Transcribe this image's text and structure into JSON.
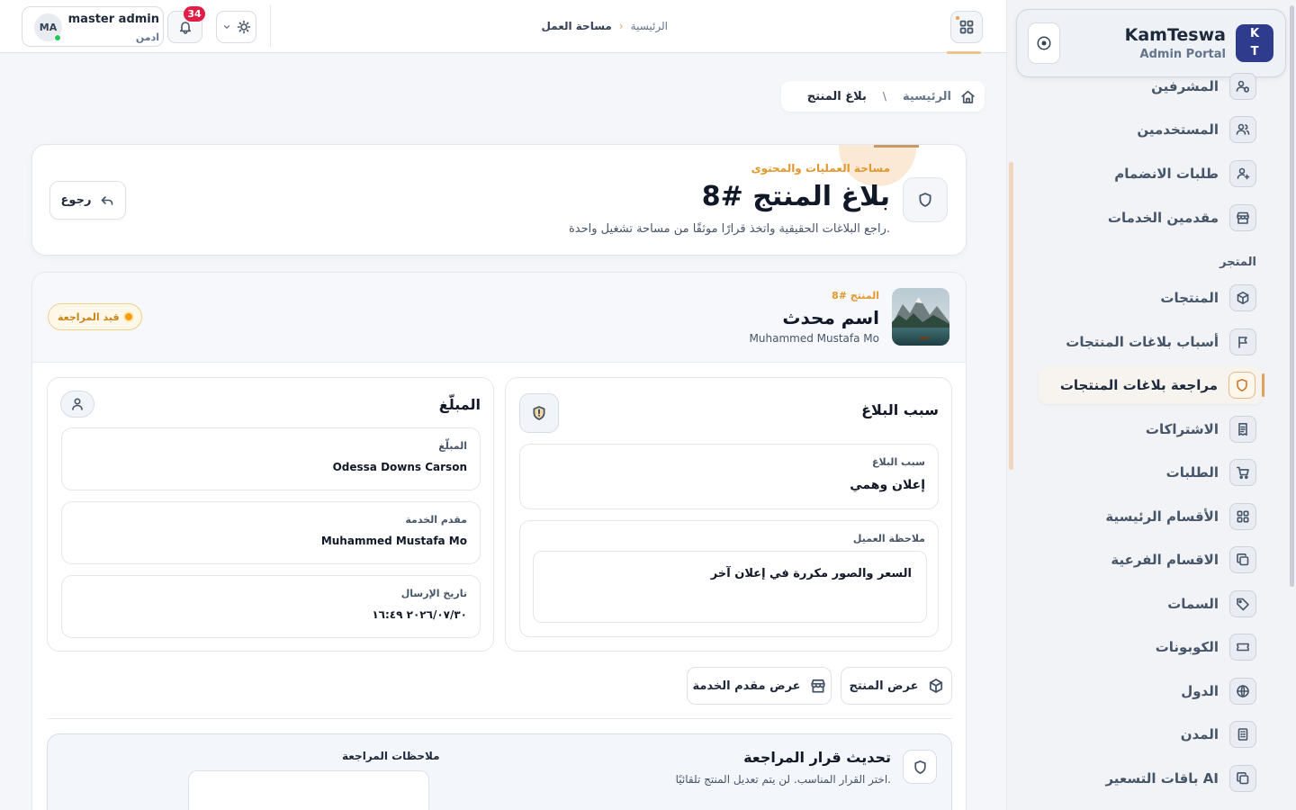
{
  "sidebar": {
    "brand_name": "KamTeswa",
    "brand_sub": "Admin Portal",
    "logo_line1": "K",
    "logo_line2": "T",
    "section_store": "المتجر",
    "items": [
      {
        "label": "المشرفين",
        "icon": "users-shield-icon"
      },
      {
        "label": "المستخدمين",
        "icon": "users-icon"
      },
      {
        "label": "طلبات الانضمام",
        "icon": "user-plus-icon"
      },
      {
        "label": "مقدمين الخدمات",
        "icon": "store-icon"
      },
      {
        "label": "المنتجات",
        "icon": "box-icon"
      },
      {
        "label": "أسباب بلاغات المنتجات",
        "icon": "flag-icon"
      },
      {
        "label": "مراجعة بلاغات المنتجات",
        "icon": "shield-icon",
        "active": true
      },
      {
        "label": "الاشتراكات",
        "icon": "receipt-icon"
      },
      {
        "label": "الطلبات",
        "icon": "cart-icon"
      },
      {
        "label": "الأقسام الرئيسية",
        "icon": "grid-icon"
      },
      {
        "label": "الاقسام الفرعية",
        "icon": "layers-icon"
      },
      {
        "label": "السمات",
        "icon": "tag-icon"
      },
      {
        "label": "الكوبونات",
        "icon": "ticket-icon"
      },
      {
        "label": "الدول",
        "icon": "globe-icon"
      },
      {
        "label": "المدن",
        "icon": "building-icon"
      },
      {
        "label": "باقات التسعير AI",
        "icon": "copy-icon"
      }
    ]
  },
  "topbar": {
    "breadcrumb_home": "الرئيسية",
    "breadcrumb_separator": "›",
    "breadcrumb_current": "مساحة العمل",
    "notifications_count": "34",
    "user_initials": "MA",
    "user_name": "master admin",
    "user_role": "ادمن"
  },
  "page": {
    "crumb_home": "الرئيسية",
    "crumb_sep": "\\",
    "crumb_current": "بلاغ المنتج",
    "kicker": "مساحة العمليات والمحتوى",
    "title": "بلاغ المنتج #8",
    "description": "راجع البلاغات الحقيقية واتخذ قرارًا موثقًا من مساحة تشغيل واحدة.",
    "back_label": "رجوع"
  },
  "product": {
    "number": "المنتج #8",
    "name": "اسم محدث",
    "provider": "Muhammed Mustafa Mo",
    "status": "قيد المراجعة",
    "status_color": "#f59e0b"
  },
  "reason_panel": {
    "title": "سبب البلاغ",
    "reason_label": "سبب البلاغ",
    "reason_value": "إعلان وهمي",
    "note_label": "ملاحظة العميل",
    "note_value": "السعر والصور مكررة في إعلان آخر"
  },
  "reporter_panel": {
    "title": "المبلّغ",
    "reporter_label": "المبلّغ",
    "reporter_value": "Odessa Downs Carson",
    "provider_label": "مقدم الخدمة",
    "provider_value": "Muhammed Mustafa Mo",
    "date_label": "تاريخ الإرسال",
    "date_value": "٢٠٢٦/٠٧/٣٠ ١٦:٤٩"
  },
  "actions": {
    "view_product": "عرض المنتج",
    "view_provider": "عرض مقدم الخدمة"
  },
  "decision": {
    "title": "تحديث قرار المراجعة",
    "subtitle": "اختر القرار المناسب. لن يتم تعديل المنتج تلقائيًا.",
    "notes_label": "ملاحظات المراجعة"
  },
  "colors": {
    "accent": "#e0982f",
    "brand": "#2f3b8c",
    "danger_badge": "#e11d48",
    "online": "#22c55e"
  }
}
